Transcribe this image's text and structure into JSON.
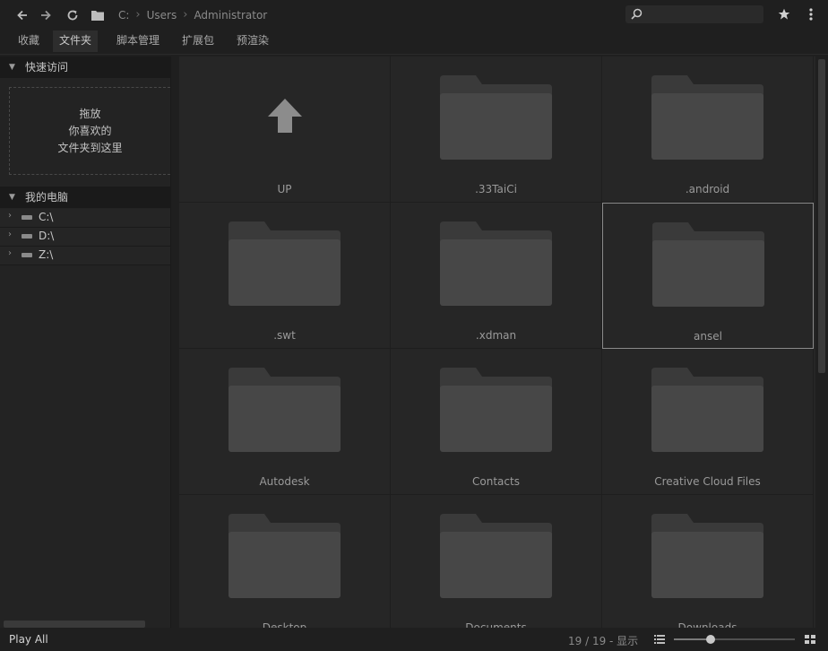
{
  "topbar": {
    "breadcrumb": [
      "C:",
      "Users",
      "Administrator"
    ],
    "search_placeholder": ""
  },
  "tabs": [
    {
      "label": "收藏",
      "active": false
    },
    {
      "label": "文件夹",
      "active": true
    },
    {
      "label": "脚本管理",
      "active": false
    },
    {
      "label": "扩展包",
      "active": false
    },
    {
      "label": "预渲染",
      "active": false
    }
  ],
  "sidebar": {
    "quick_access_title": "快速访问",
    "dropzone_lines": [
      "拖放",
      "你喜欢的",
      "文件夹到这里"
    ],
    "my_computer_title": "我的电脑",
    "drives": [
      "C:\\",
      "D:\\",
      "Z:\\"
    ]
  },
  "grid": {
    "items": [
      {
        "name": "UP",
        "type": "up"
      },
      {
        "name": ".33TaiCi",
        "type": "folder"
      },
      {
        "name": ".android",
        "type": "folder"
      },
      {
        "name": ".swt",
        "type": "folder"
      },
      {
        "name": ".xdman",
        "type": "folder"
      },
      {
        "name": "ansel",
        "type": "folder",
        "selected": true
      },
      {
        "name": "Autodesk",
        "type": "folder"
      },
      {
        "name": "Contacts",
        "type": "folder"
      },
      {
        "name": "Creative Cloud Files",
        "type": "folder"
      },
      {
        "name": "Desktop",
        "type": "folder"
      },
      {
        "name": "Documents",
        "type": "folder"
      },
      {
        "name": "Downloads",
        "type": "folder"
      }
    ]
  },
  "statusbar": {
    "play_all": "Play All",
    "count": "19 / 19 - 显示",
    "zoom_level": 0.3
  },
  "colors": {
    "background": "#1f1f1f",
    "folder_back": "#3a3a3a",
    "folder_front": "#474747",
    "up_arrow": "#8c8c8c"
  }
}
